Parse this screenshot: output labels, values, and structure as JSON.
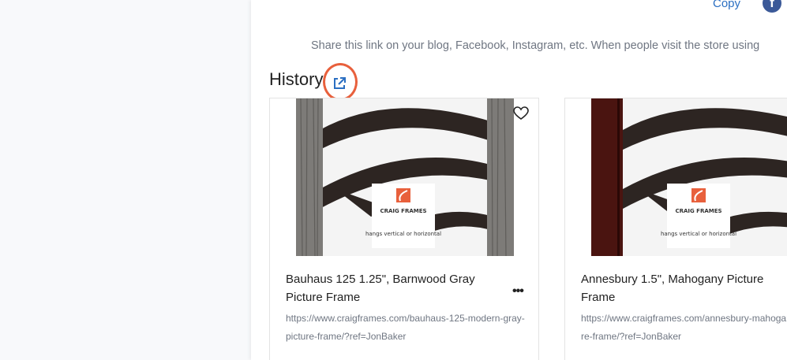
{
  "share": {
    "copy_label": "Copy",
    "facebook_glyph": "f",
    "description": "Share this link on your blog, Facebook, Instagram, etc. When people visit the store using"
  },
  "history": {
    "title": "History",
    "open_icon": "external-link-icon",
    "highlight_color": "#e8603c",
    "items": [
      {
        "title": "Bauhaus 125 1.25\", Barnwood Gray Picture Frame",
        "url": "https://www.craigframes.com/bauhaus-125-modern-gray-picture-frame/?ref=JonBaker",
        "frame_color": "#7d7b78",
        "image_logo": "CRAIG FRAMES",
        "image_caption": "hangs vertical or horizontal"
      },
      {
        "title": "Annesbury 1.5\", Mahogany Picture Frame",
        "url": "https://www.craigframes.com/annesbury-mahogany-picture-frame/?ref=JonBaker",
        "frame_color": "#4a1410",
        "image_logo": "CRAIG FRAMES",
        "image_caption": "hangs vertical or horizontal"
      }
    ]
  }
}
